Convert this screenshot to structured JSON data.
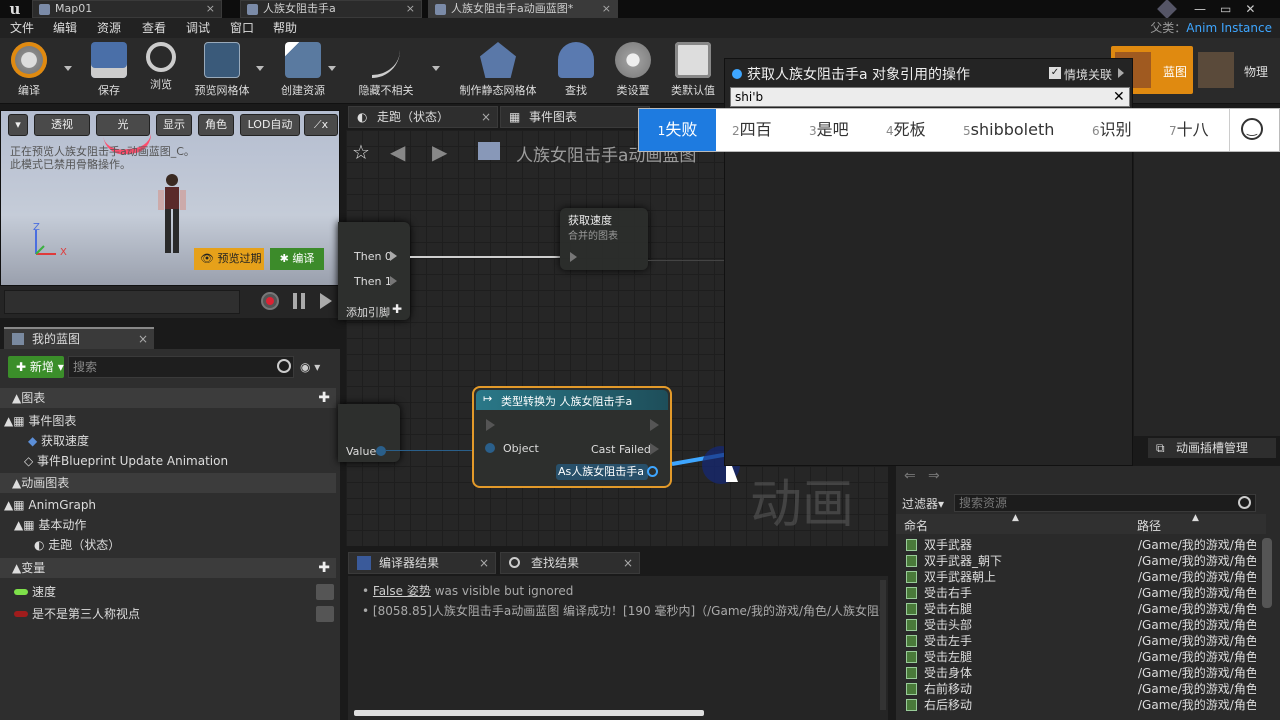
{
  "window": {
    "tabs": [
      {
        "label": "Map01"
      },
      {
        "label": "人族女阻击手a"
      },
      {
        "label": "人族女阻击手a动画蓝图*"
      }
    ],
    "parent_label": "父类：",
    "parent_value": "Anim Instance"
  },
  "menu": [
    "文件",
    "编辑",
    "资源",
    "查看",
    "调试",
    "窗口",
    "帮助"
  ],
  "toolbar": {
    "compile": "编译",
    "save": "保存",
    "browse": "浏览",
    "preview_mesh": "预览网格体",
    "create_asset": "创建资源",
    "hide_unrelated": "隐藏不相关",
    "make_static_mesh": "制作静态网格体",
    "find": "查找",
    "class_settings": "类设置",
    "class_defaults": "类默认值",
    "blueprint": "蓝图",
    "physics": "物理"
  },
  "viewport": {
    "perspective": "透视",
    "lit": "光",
    "show": "显示",
    "character": "角色",
    "lod": "LOD自动",
    "message_line1": "正在预览人族女阻击手a动画蓝图_C。",
    "message_line2": "此模式已禁用骨骼操作。",
    "axis_z": "Z",
    "axis_x": "X",
    "preview_expired": "预览过期",
    "compile": "编译"
  },
  "my_blueprint": {
    "tab": "我的蓝图",
    "add_new": "新增",
    "search_placeholder": "搜索",
    "graphs_header": "图表",
    "event_graph": "事件图表",
    "get_speed": "获取速度",
    "blueprint_update": "事件Blueprint Update Animation",
    "anim_graphs_header": "动画图表",
    "anim_graph": "AnimGraph",
    "basic_action": "基本动作",
    "run_state": "走跑（状态）",
    "variables_header": "变量",
    "var_speed": "速度",
    "var_third_person": "是不是第三人称视点"
  },
  "graph": {
    "tab_run": "走跑（状态）",
    "tab_event": "事件图表",
    "title": "人族女阻击手a动画蓝图",
    "then0": "Then 0",
    "then1": "Then 1",
    "add_pin": "添加引脚",
    "get_speed_title": "获取速度",
    "get_speed_sub": "合并的图表",
    "value": "Value",
    "cast_title": "类型转换为 人族女阻击手a",
    "object": "Object",
    "cast_failed": "Cast Failed",
    "as_pin": "As人族女阻击手a",
    "watermark": "动画"
  },
  "popup": {
    "title": "获取人族女阻击手a 对象引用的操作",
    "context_sensitive": "情境关联",
    "input_value": "shi'b"
  },
  "ime": {
    "candidates": [
      {
        "n": "1",
        "t": "失败"
      },
      {
        "n": "2",
        "t": "四百"
      },
      {
        "n": "3",
        "t": "是吧"
      },
      {
        "n": "4",
        "t": "死板"
      },
      {
        "n": "5",
        "t": "shibboleth"
      },
      {
        "n": "6",
        "t": "识别"
      },
      {
        "n": "7",
        "t": "十八"
      }
    ]
  },
  "content_browser": {
    "anim_slot_tab": "动画插槽管理",
    "filters": "过滤器",
    "search_placeholder": "搜索资源",
    "col_name": "命名",
    "col_path": "路径",
    "assets": [
      {
        "name": "双手武器",
        "path": "/Game/我的游戏/角色"
      },
      {
        "name": "双手武器_朝下",
        "path": "/Game/我的游戏/角色"
      },
      {
        "name": "双手武器朝上",
        "path": "/Game/我的游戏/角色"
      },
      {
        "name": "受击右手",
        "path": "/Game/我的游戏/角色"
      },
      {
        "name": "受击右腿",
        "path": "/Game/我的游戏/角色"
      },
      {
        "name": "受击头部",
        "path": "/Game/我的游戏/角色"
      },
      {
        "name": "受击左手",
        "path": "/Game/我的游戏/角色"
      },
      {
        "name": "受击左腿",
        "path": "/Game/我的游戏/角色"
      },
      {
        "name": "受击身体",
        "path": "/Game/我的游戏/角色"
      },
      {
        "name": "右前移动",
        "path": "/Game/我的游戏/角色"
      },
      {
        "name": "右后移动",
        "path": "/Game/我的游戏/角色"
      }
    ]
  },
  "compiler": {
    "tab_results": "编译器结果",
    "tab_find": "查找结果",
    "msg1_link": "False 姿势",
    "msg1_rest": "was visible but ignored",
    "msg2": "[8058.85]人族女阻击手a动画蓝图 编译成功！[190 毫秒内]（/Game/我的游戏/角色/人族女阻击"
  },
  "colors": {
    "accent_orange": "#e08a10",
    "accent_green": "#3b8e2a",
    "ime_selected": "#1e7be0",
    "link_blue": "#3ea6ff"
  }
}
